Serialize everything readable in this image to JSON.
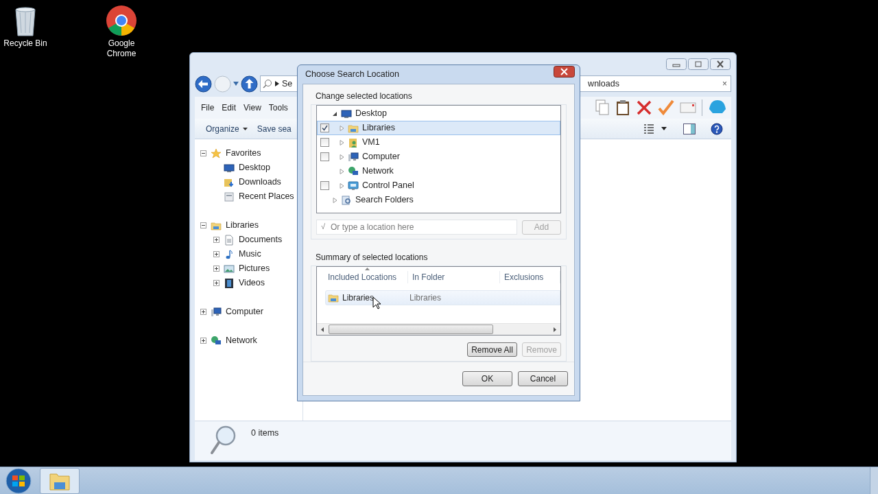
{
  "desktop_icons": [
    {
      "label": "Recycle Bin",
      "kind": "recycle"
    },
    {
      "label": "Google Chrome",
      "kind": "browser"
    }
  ],
  "explorer": {
    "address": {
      "left_text": "Se",
      "right_text": "wnloads",
      "clear": "×"
    },
    "menu": [
      "File",
      "Edit",
      "View",
      "Tools"
    ],
    "organize": "Organize",
    "save_search": "Save sea",
    "nav": [
      {
        "label": "Favorites",
        "kind": "star",
        "expander": true,
        "expanded": true,
        "children": [
          {
            "label": "Desktop",
            "kind": "desktop",
            "expander": false
          },
          {
            "label": "Downloads",
            "kind": "downloads",
            "expander": false
          },
          {
            "label": "Recent Places",
            "kind": "recent",
            "expander": false
          }
        ]
      },
      {
        "label": "Libraries",
        "kind": "library",
        "expander": true,
        "expanded": true,
        "children": [
          {
            "label": "Documents",
            "kind": "document",
            "expander": true,
            "expanded": false
          },
          {
            "label": "Music",
            "kind": "music",
            "expander": true,
            "expanded": false
          },
          {
            "label": "Pictures",
            "kind": "pictures",
            "expander": true,
            "expanded": false
          },
          {
            "label": "Videos",
            "kind": "videos",
            "expander": true,
            "expanded": false
          }
        ]
      },
      {
        "label": "Computer",
        "kind": "computer",
        "expander": true,
        "expanded": false
      },
      {
        "label": "Network",
        "kind": "network",
        "expander": true,
        "expanded": false
      }
    ],
    "status": "0 items"
  },
  "dialog": {
    "title": "Choose Search Location",
    "locations_group": "Change selected locations",
    "tree": [
      {
        "label": "Desktop",
        "kind": "desktop",
        "expanded": true,
        "checkbox": false,
        "selected": false,
        "children": [
          {
            "label": "Libraries",
            "kind": "library",
            "expanded": false,
            "checkbox": true,
            "checked": true,
            "selected": true
          },
          {
            "label": "VM1",
            "kind": "user",
            "expanded": false,
            "checkbox": true,
            "checked": false,
            "selected": false
          },
          {
            "label": "Computer",
            "kind": "computer",
            "expanded": false,
            "checkbox": true,
            "checked": false,
            "selected": false
          },
          {
            "label": "Network",
            "kind": "network",
            "expanded": false,
            "checkbox": false,
            "selected": false
          },
          {
            "label": "Control Panel",
            "kind": "control",
            "expanded": false,
            "checkbox": true,
            "checked": false,
            "selected": false
          }
        ]
      },
      {
        "label": "Search Folders",
        "kind": "search_folders",
        "expanded": false,
        "checkbox": false,
        "selected": false
      }
    ],
    "location_field": {
      "prefix": "√",
      "placeholder": "Or type a location here"
    },
    "add_button": {
      "label": "Add",
      "disabled": true
    },
    "summary_group": "Summary of selected locations",
    "columns": [
      "Included Locations",
      "In Folder",
      "Exclusions"
    ],
    "rows": [
      {
        "location": "Libraries",
        "folder": "Libraries",
        "selected": true
      }
    ],
    "remove_all": {
      "label": "Remove All",
      "disabled": false
    },
    "remove": {
      "label": "Remove",
      "disabled": true
    },
    "ok": "OK",
    "cancel": "Cancel"
  }
}
